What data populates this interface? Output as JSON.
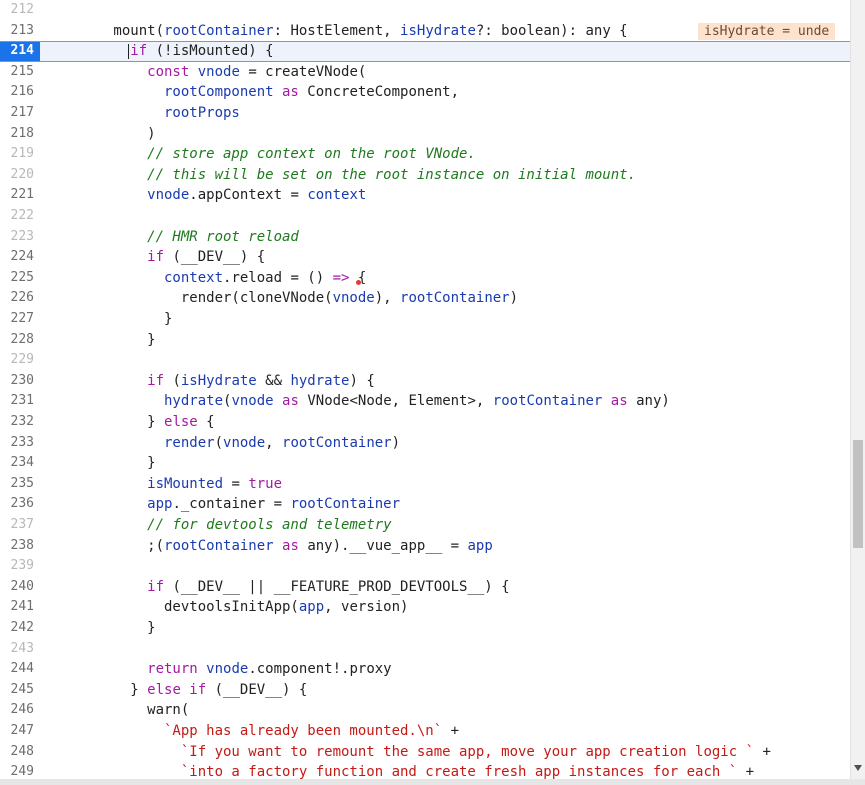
{
  "editor": {
    "active_line": 214,
    "inline_hint": "isHydrate = unde",
    "lines": [
      {
        "n": 212,
        "dim": true,
        "tokens": []
      },
      {
        "n": 213,
        "tokens": [
          [
            "pl",
            "        mount("
          ],
          [
            "var",
            "rootContainer"
          ],
          [
            "pl",
            ": HostElement, "
          ],
          [
            "var",
            "isHydrate"
          ],
          [
            "pl",
            "?: boolean): any {"
          ]
        ]
      },
      {
        "n": 214,
        "tokens": [
          [
            "kw",
            "          if"
          ],
          [
            "pl",
            " (!isMounted) {"
          ]
        ]
      },
      {
        "n": 215,
        "tokens": [
          [
            "kw",
            "            const"
          ],
          [
            "pl",
            " "
          ],
          [
            "var",
            "vnode"
          ],
          [
            "pl",
            " = createVNode("
          ]
        ]
      },
      {
        "n": 216,
        "tokens": [
          [
            "var",
            "              rootComponent"
          ],
          [
            "kw",
            " as"
          ],
          [
            "pl",
            " ConcreteComponent,"
          ]
        ]
      },
      {
        "n": 217,
        "tokens": [
          [
            "var",
            "              rootProps"
          ]
        ]
      },
      {
        "n": 218,
        "tokens": [
          [
            "pl",
            "            )"
          ]
        ]
      },
      {
        "n": 219,
        "dim": true,
        "tokens": [
          [
            "cm",
            "            // store app context on the root VNode."
          ]
        ]
      },
      {
        "n": 220,
        "dim": true,
        "tokens": [
          [
            "cm",
            "            // this will be set on the root instance on initial mount."
          ]
        ]
      },
      {
        "n": 221,
        "tokens": [
          [
            "var",
            "            vnode"
          ],
          [
            "pl",
            ".appContext = "
          ],
          [
            "var",
            "context"
          ]
        ]
      },
      {
        "n": 222,
        "dim": true,
        "tokens": []
      },
      {
        "n": 223,
        "dim": true,
        "tokens": [
          [
            "cm",
            "            // HMR root reload"
          ]
        ]
      },
      {
        "n": 224,
        "tokens": [
          [
            "kw",
            "            if"
          ],
          [
            "pl",
            " (__DEV__) {"
          ]
        ]
      },
      {
        "n": 225,
        "tokens": [
          [
            "var",
            "              context"
          ],
          [
            "pl",
            ".reload = () "
          ],
          [
            "kw",
            "=>"
          ],
          [
            "pl",
            " {"
          ]
        ]
      },
      {
        "n": 226,
        "tokens": [
          [
            "pl",
            "                render(cloneVNode("
          ],
          [
            "var",
            "vnode"
          ],
          [
            "pl",
            "), "
          ],
          [
            "var",
            "rootContainer"
          ],
          [
            "pl",
            ")"
          ]
        ]
      },
      {
        "n": 227,
        "tokens": [
          [
            "pl",
            "              }"
          ]
        ]
      },
      {
        "n": 228,
        "tokens": [
          [
            "pl",
            "            }"
          ]
        ]
      },
      {
        "n": 229,
        "dim": true,
        "tokens": []
      },
      {
        "n": 230,
        "tokens": [
          [
            "kw",
            "            if"
          ],
          [
            "pl",
            " ("
          ],
          [
            "var",
            "isHydrate"
          ],
          [
            "pl",
            " && "
          ],
          [
            "var",
            "hydrate"
          ],
          [
            "pl",
            ") {"
          ]
        ]
      },
      {
        "n": 231,
        "tokens": [
          [
            "var",
            "              hydrate"
          ],
          [
            "pl",
            "("
          ],
          [
            "var",
            "vnode"
          ],
          [
            "kw",
            " as"
          ],
          [
            "pl",
            " VNode<Node, Element>, "
          ],
          [
            "var",
            "rootContainer"
          ],
          [
            "kw",
            " as"
          ],
          [
            "pl",
            " any)"
          ]
        ]
      },
      {
        "n": 232,
        "tokens": [
          [
            "pl",
            "            } "
          ],
          [
            "kw",
            "else"
          ],
          [
            "pl",
            " {"
          ]
        ]
      },
      {
        "n": 233,
        "tokens": [
          [
            "var",
            "              render"
          ],
          [
            "pl",
            "("
          ],
          [
            "var",
            "vnode"
          ],
          [
            "pl",
            ", "
          ],
          [
            "var",
            "rootContainer"
          ],
          [
            "pl",
            ")"
          ]
        ]
      },
      {
        "n": 234,
        "tokens": [
          [
            "pl",
            "            }"
          ]
        ]
      },
      {
        "n": 235,
        "tokens": [
          [
            "var",
            "            isMounted"
          ],
          [
            "pl",
            " = "
          ],
          [
            "lit",
            "true"
          ]
        ]
      },
      {
        "n": 236,
        "tokens": [
          [
            "var",
            "            app"
          ],
          [
            "pl",
            "._container = "
          ],
          [
            "var",
            "rootContainer"
          ]
        ]
      },
      {
        "n": 237,
        "dim": true,
        "tokens": [
          [
            "cm",
            "            // for devtools and telemetry"
          ]
        ]
      },
      {
        "n": 238,
        "tokens": [
          [
            "pl",
            "            ;("
          ],
          [
            "var",
            "rootContainer"
          ],
          [
            "kw",
            " as"
          ],
          [
            "pl",
            " any).__vue_app__ = "
          ],
          [
            "var",
            "app"
          ]
        ]
      },
      {
        "n": 239,
        "dim": true,
        "tokens": []
      },
      {
        "n": 240,
        "tokens": [
          [
            "kw",
            "            if"
          ],
          [
            "pl",
            " (__DEV__ || __FEATURE_PROD_DEVTOOLS__) {"
          ]
        ]
      },
      {
        "n": 241,
        "tokens": [
          [
            "pl",
            "              devtoolsInitApp("
          ],
          [
            "var",
            "app"
          ],
          [
            "pl",
            ", version)"
          ]
        ]
      },
      {
        "n": 242,
        "tokens": [
          [
            "pl",
            "            }"
          ]
        ]
      },
      {
        "n": 243,
        "dim": true,
        "tokens": []
      },
      {
        "n": 244,
        "tokens": [
          [
            "kw",
            "            return"
          ],
          [
            "pl",
            " "
          ],
          [
            "var",
            "vnode"
          ],
          [
            "pl",
            ".component!.proxy"
          ]
        ]
      },
      {
        "n": 245,
        "tokens": [
          [
            "pl",
            "          } "
          ],
          [
            "kw",
            "else if"
          ],
          [
            "pl",
            " (__DEV__) {"
          ]
        ]
      },
      {
        "n": 246,
        "tokens": [
          [
            "pl",
            "            warn("
          ]
        ]
      },
      {
        "n": 247,
        "tokens": [
          [
            "str",
            "              `App has already been mounted.\\n`"
          ],
          [
            "pl",
            " +"
          ]
        ]
      },
      {
        "n": 248,
        "tokens": [
          [
            "str",
            "                `If you want to remount the same app, move your app creation logic `"
          ],
          [
            "pl",
            " +"
          ]
        ]
      },
      {
        "n": 249,
        "tokens": [
          [
            "str",
            "                `into a factory function and create fresh app instances for each `"
          ],
          [
            "pl",
            " +"
          ]
        ]
      }
    ]
  }
}
